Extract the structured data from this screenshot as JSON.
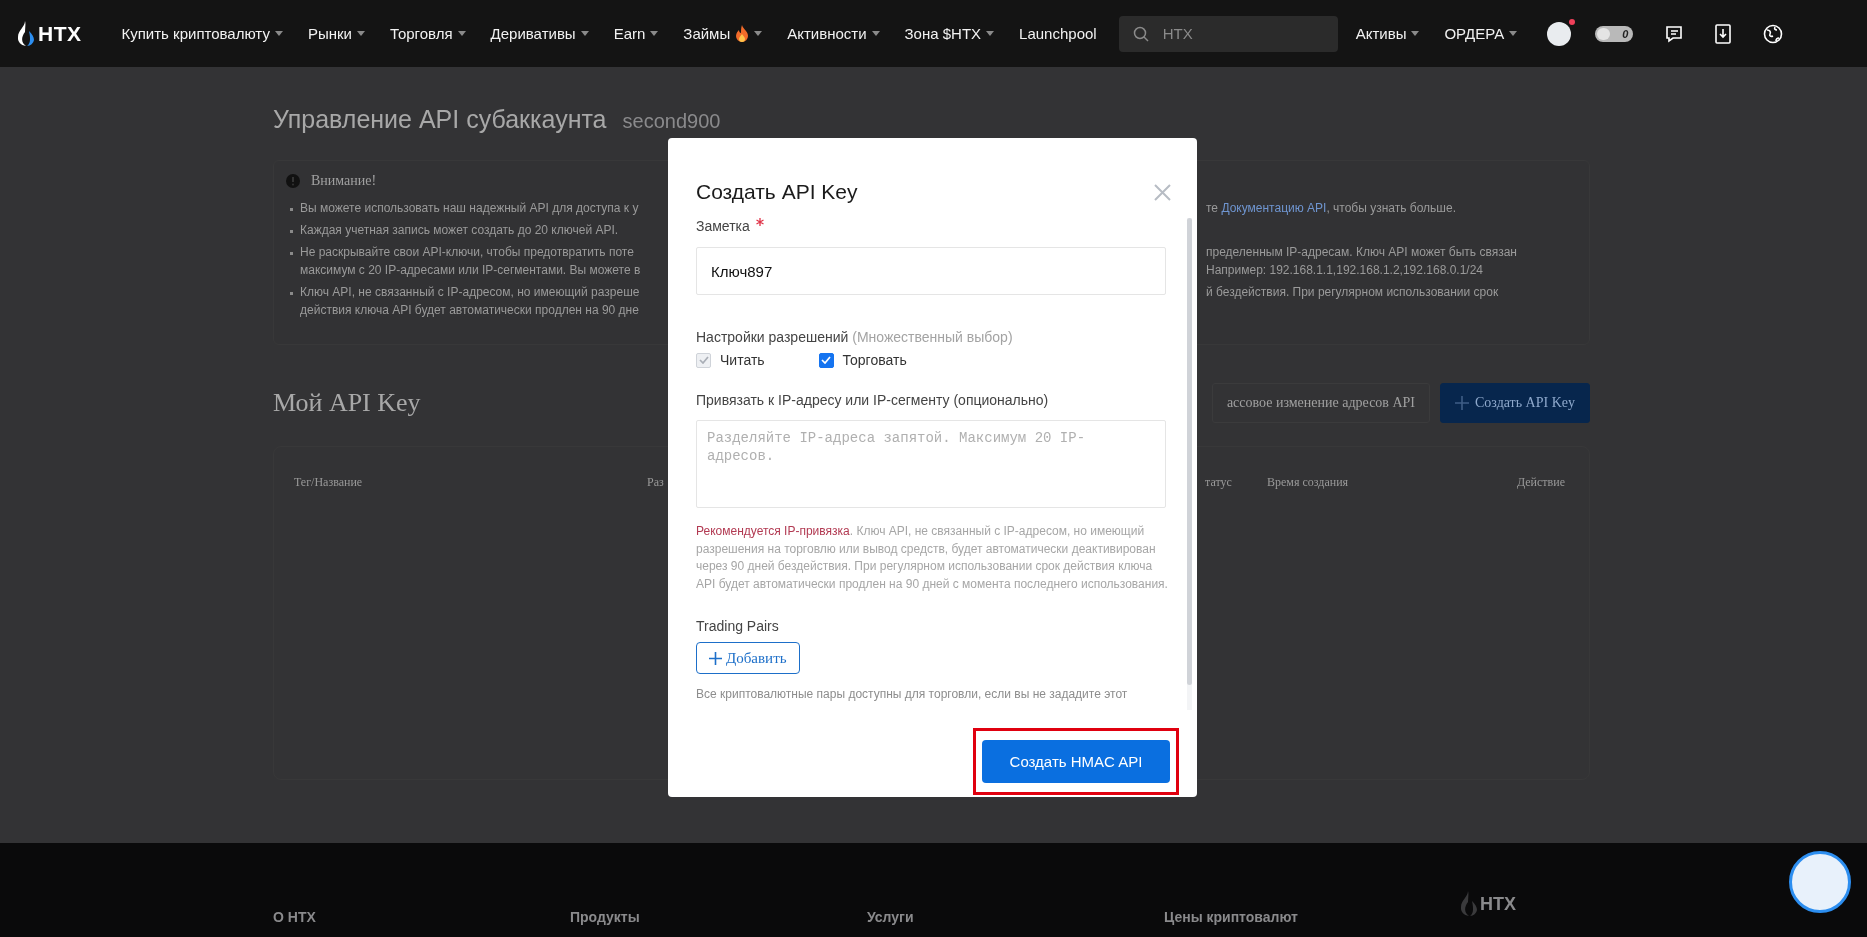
{
  "header": {
    "logo": "HTX",
    "nav": [
      {
        "label": "Купить криптовалюту",
        "caret": true,
        "hot": false
      },
      {
        "label": "Рынки",
        "caret": true,
        "hot": false
      },
      {
        "label": "Торговля",
        "caret": true,
        "hot": false
      },
      {
        "label": "Деривативы",
        "caret": true,
        "hot": false
      },
      {
        "label": "Earn",
        "caret": true,
        "hot": false
      },
      {
        "label": "Займы",
        "caret": true,
        "hot": true
      },
      {
        "label": "Активности",
        "caret": true,
        "hot": false
      },
      {
        "label": "Зона $HTX",
        "caret": true,
        "hot": false
      },
      {
        "label": "Launchpool",
        "caret": false,
        "hot": false
      }
    ],
    "search": {
      "placeholder": "HTX"
    },
    "menus": [
      {
        "label": "Активы",
        "caret": true
      },
      {
        "label": "ОРДЕРА",
        "caret": true
      }
    ],
    "notification_dot": true,
    "points": "0"
  },
  "page": {
    "title": "Управление API субаккаунта",
    "subaccount": "second900",
    "notice": {
      "title": "Внимание!",
      "items": [
        {
          "lines": [
            {
              "left": "Вы можете использовать наш надежный API для доступа к у",
              "right": [
                {
                  "kind": "text",
                  "text": "те "
                },
                {
                  "kind": "link",
                  "text": "Документацию API"
                },
                {
                  "kind": "text",
                  "text": ", чтобы узнать больше."
                }
              ]
            }
          ]
        },
        {
          "lines": [
            {
              "left": "Каждая учетная запись может создать до 20 ключей API."
            }
          ]
        },
        {
          "lines": [
            {
              "left": "Не раскрывайте свои API-ключи, чтобы предотвратить поте",
              "right": [
                {
                  "kind": "text",
                  "text": "пределенным IP-адресам. Ключ API может быть связан"
                }
              ]
            },
            {
              "left": "максимум с 20 IP-адресами или IP-сегментами. Вы можете в",
              "right": [
                {
                  "kind": "text",
                  "text": "Например: 192.168.1.1,192.168.1.2,192.168.0.1/24"
                }
              ]
            }
          ]
        },
        {
          "lines": [
            {
              "left": "Ключ API, не связанный с IP-адресом, но имеющий разреше",
              "right": [
                {
                  "kind": "text",
                  "text": "й бездействия. При регулярном использовании срок"
                }
              ]
            },
            {
              "left": "действия ключа API будет автоматически продлен на 90 дне"
            }
          ]
        }
      ]
    },
    "keys_title": "Мой API Key",
    "actions": [
      {
        "label": "ассовое изменение адресов API",
        "kind": "outline"
      },
      {
        "label": "Создать API Key",
        "kind": "primary"
      }
    ],
    "table": {
      "columns_left": [
        "Тег/Название",
        "Раз"
      ],
      "columns_right": [
        "татус",
        "Время создания",
        "Действие"
      ]
    }
  },
  "modal": {
    "title": "Создать API Key",
    "note_field": {
      "label": "Заметка",
      "required": true,
      "value": "Ключ897"
    },
    "permissions": {
      "label": "Настройки разрешений",
      "hint": "(Множественный выбор)",
      "options": [
        {
          "label": "Читать",
          "checked": true,
          "disabled": true
        },
        {
          "label": "Торговать",
          "checked": true,
          "disabled": false
        }
      ]
    },
    "ip_field": {
      "label": "Привязать к IP-адресу или IP-сегменту (опционально)",
      "placeholder": "Разделяйте IP-адреса запятой. Максимум 20 IP-адресов."
    },
    "ip_warning": {
      "lead": "Рекомендуется IP-привязка",
      "text": ". Ключ API, не связанный с IP-адресом, но имеющий разрешения на торговлю или вывод средств, будет автоматически деактивирован через 90 дней бездействия. При регулярном использовании срок действия ключа API будет автоматически продлен на 90 дней с момента последнего использования."
    },
    "pairs": {
      "label": "Trading Pairs",
      "add": "Добавить",
      "note": "Все криптовалютные пары доступны для торговли, если вы не зададите этот"
    },
    "submit": {
      "label": "Создать HMAC API",
      "highlighted": true
    }
  },
  "footer": {
    "columns": [
      "О HTX",
      "Продукты",
      "Услуги",
      "Цены криптовалют"
    ],
    "logo": "HTX"
  }
}
